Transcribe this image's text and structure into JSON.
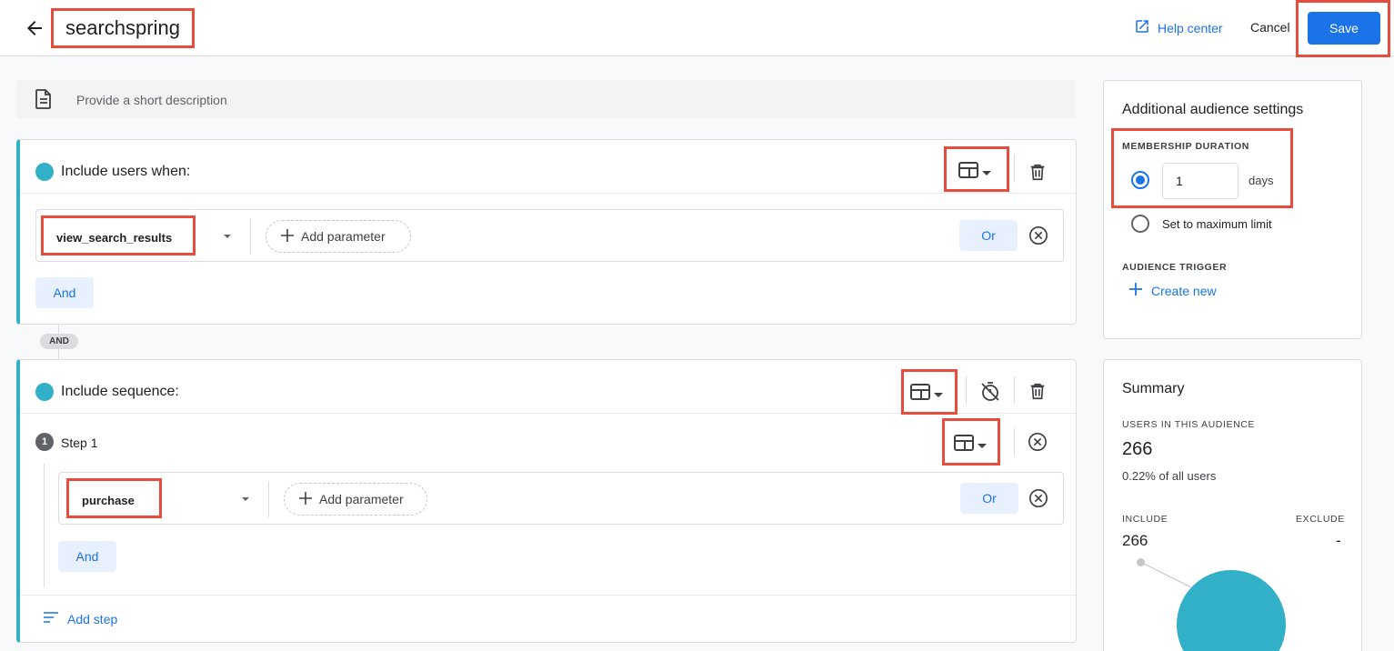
{
  "header": {
    "title": "searchspring",
    "help_label": "Help center",
    "cancel_label": "Cancel",
    "save_label": "Save"
  },
  "description": {
    "placeholder": "Provide a short description"
  },
  "condition_group": {
    "title": "Include users when:",
    "event": "view_search_results",
    "add_parameter_label": "Add parameter",
    "or_label": "Or",
    "and_label": "And"
  },
  "connector_label": "AND",
  "sequence": {
    "title": "Include sequence:",
    "step_number": "1",
    "step_label": "Step 1",
    "event": "purchase",
    "add_parameter_label": "Add parameter",
    "or_label": "Or",
    "and_label": "And",
    "add_step_label": "Add step"
  },
  "settings": {
    "title": "Additional audience settings",
    "membership_label": "MEMBERSHIP DURATION",
    "duration_value": "1",
    "duration_unit": "days",
    "max_limit_label": "Set to maximum limit",
    "trigger_label": "AUDIENCE TRIGGER",
    "create_new_label": "Create new"
  },
  "summary": {
    "title": "Summary",
    "users_label": "USERS IN THIS AUDIENCE",
    "users_count": "266",
    "users_share": "0.22% of all users",
    "include_label": "INCLUDE",
    "exclude_label": "EXCLUDE",
    "include_value": "266",
    "exclude_value": "-"
  },
  "colors": {
    "accent": "#1a73e8",
    "teal": "#31b0c7",
    "highlight": "#e74c3c"
  },
  "icons": [
    "back-arrow-icon",
    "external-link-icon",
    "document-icon",
    "view-type-icon",
    "trash-icon",
    "timer-off-icon",
    "remove-circle-icon",
    "plus-icon",
    "add-step-icon"
  ]
}
